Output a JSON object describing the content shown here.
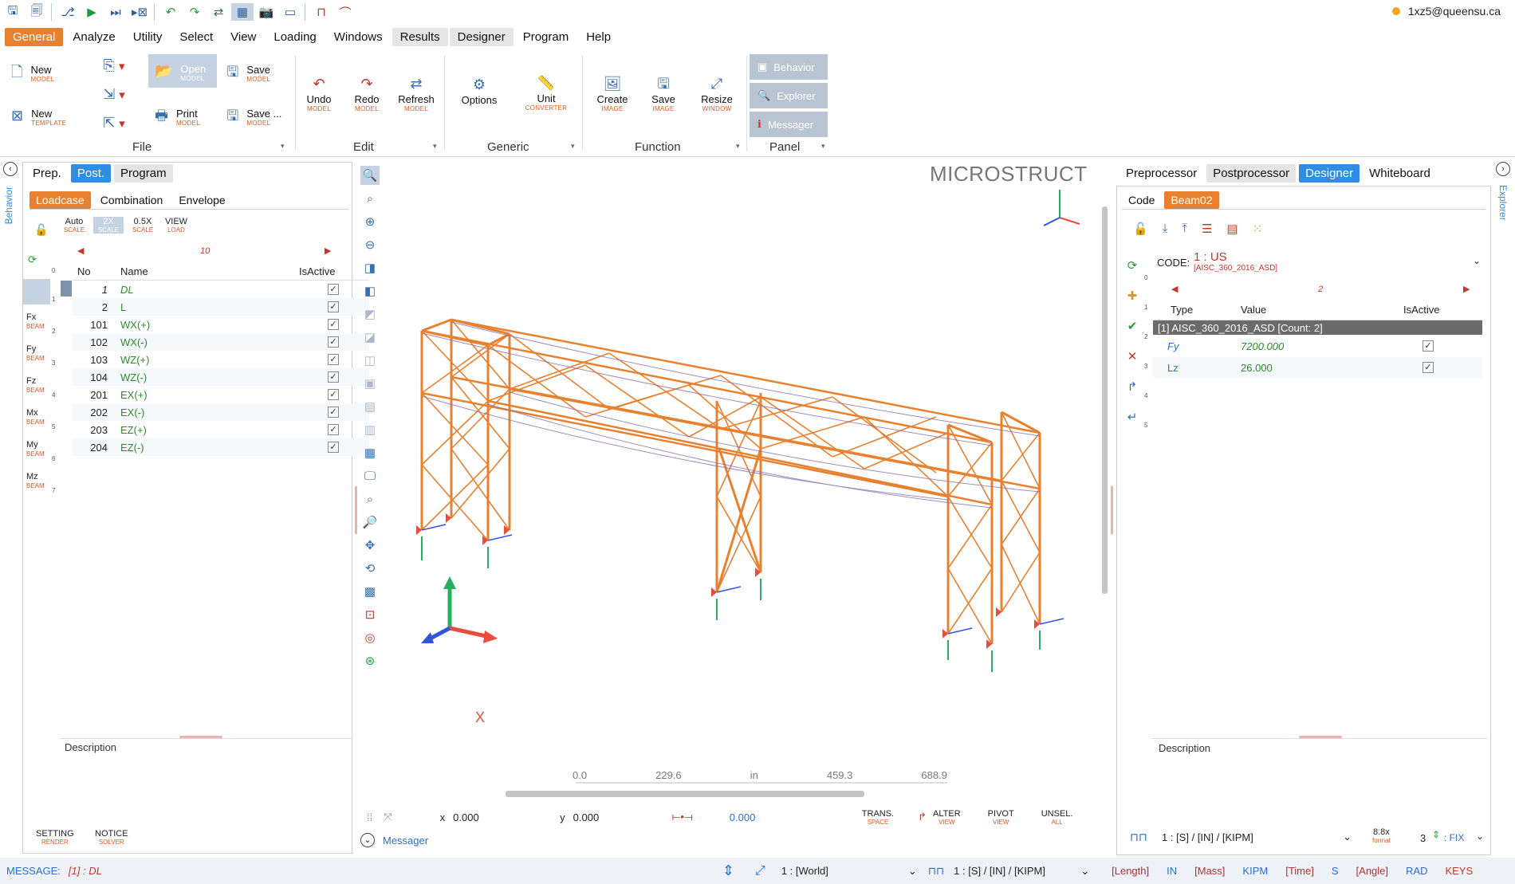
{
  "quick_access": {
    "icons": [
      "save-icon",
      "save-all-icon",
      "flow-icon",
      "run-icon",
      "step-icon",
      "next-frame-icon",
      "undo-icon",
      "redo-icon",
      "swap-icon",
      "layout-icon",
      "camera-icon",
      "window-icon",
      "beam-icon",
      "bridge-icon"
    ]
  },
  "user": {
    "email": "1xz5@queensu.ca",
    "status_color": "#f5a51c"
  },
  "menu": {
    "items": [
      "General",
      "Analyze",
      "Utility",
      "Select",
      "View",
      "Loading",
      "Windows",
      "Results",
      "Designer",
      "Program",
      "Help"
    ]
  },
  "ribbon": {
    "file": {
      "new_model": "New",
      "new_model_sub": "MODEL",
      "new_template": "New",
      "new_template_sub": "TEMPLATE",
      "open": "Open",
      "open_sub": "MODEL",
      "print": "Print",
      "print_sub": "MODEL",
      "save": "Save",
      "save_sub": "MODEL",
      "save_as": "Save ...",
      "save_as_sub": "MODEL",
      "group": "File"
    },
    "edit": {
      "undo": "Undo",
      "undo_sub": "MODEL",
      "redo": "Redo",
      "redo_sub": "MODEL",
      "refresh": "Refresh",
      "refresh_sub": "MODEL",
      "group": "Edit"
    },
    "generic": {
      "options": "Options",
      "unit": "Unit",
      "unit_sub": "CONVERTER",
      "group": "Generic"
    },
    "function": {
      "create": "Create",
      "create_sub": "IMAGE",
      "save": "Save",
      "save_sub": "IMAGE",
      "resize": "Resize",
      "resize_sub": "WINDOW",
      "group": "Function"
    },
    "panel": {
      "behavior": "Behavior",
      "explorer": "Explorer",
      "messager": "Messager",
      "group": "Panel"
    }
  },
  "left_panel": {
    "side_label": "Behavior",
    "tabs": [
      "Prep.",
      "Post.",
      "Program"
    ],
    "subtabs": [
      "Loadcase",
      "Combination",
      "Envelope"
    ],
    "scale": [
      {
        "t": "Auto",
        "s": "SCALE"
      },
      {
        "t": "2X",
        "s": "SCALE"
      },
      {
        "t": "0.5X",
        "s": "SCALE"
      },
      {
        "t": "VIEW",
        "s": "LOAD"
      }
    ],
    "pager": "10",
    "side_comps": [
      {
        "t": "Fx",
        "s": "BEAM"
      },
      {
        "t": "Fy",
        "s": "BEAM"
      },
      {
        "t": "Fz",
        "s": "BEAM"
      },
      {
        "t": "Mx",
        "s": "BEAM"
      },
      {
        "t": "My",
        "s": "BEAM"
      },
      {
        "t": "Mz",
        "s": "BEAM"
      }
    ],
    "side_nums": [
      "0",
      "1",
      "2",
      "3",
      "4",
      "5",
      "6",
      "7"
    ],
    "cols": {
      "no": "No",
      "name": "Name",
      "active": "IsActive"
    },
    "rows": [
      {
        "no": "1",
        "name": "DL"
      },
      {
        "no": "2",
        "name": "L"
      },
      {
        "no": "101",
        "name": "WX(+)"
      },
      {
        "no": "102",
        "name": "WX(-)"
      },
      {
        "no": "103",
        "name": "WZ(+)"
      },
      {
        "no": "104",
        "name": "WZ(-)"
      },
      {
        "no": "201",
        "name": "EX(+)"
      },
      {
        "no": "202",
        "name": "EX(-)"
      },
      {
        "no": "203",
        "name": "EZ(+)"
      },
      {
        "no": "204",
        "name": "EZ(-)"
      }
    ],
    "check": "✓",
    "description": "Description",
    "setting": "SETTING",
    "setting_sub": "RENDER",
    "notice": "NOTICE",
    "notice_sub": "SOLVER"
  },
  "viewport": {
    "brand": "MICROSTRUCT",
    "axis_x": "X",
    "scale_ticks": [
      "0.0",
      "229.6",
      "in",
      "459.3",
      "688.9"
    ],
    "x_label": "x",
    "x_val": "0.000",
    "y_label": "y",
    "y_val": "0.000",
    "d_val": "0.000",
    "trans": "TRANS.",
    "trans_sub": "SPACE",
    "alter": "ALTER",
    "alter_sub": "VIEW",
    "pivot": "PIVOT",
    "pivot_sub": "VIEW",
    "unsel": "UNSEL.",
    "unsel_sub": "ALL",
    "messager": "Messager",
    "frame_color": "#e8812f"
  },
  "right_panel": {
    "side_label": "Explorer",
    "tabs": [
      "Preprocessor",
      "Postprocessor",
      "Designer",
      "Whiteboard"
    ],
    "subtabs": [
      "Code",
      "Beam02"
    ],
    "code_label": "CODE:",
    "code_value": "1 : US",
    "code_sub": "[AISC_360_2016_ASD]",
    "pager": "2",
    "cols": {
      "type": "Type",
      "value": "Value",
      "active": "IsActive"
    },
    "group": "[1] AISC_360_2016_ASD   [Count: 2]",
    "rows": [
      {
        "type": "Fy",
        "value": "7200.000"
      },
      {
        "type": "Lz",
        "value": "26.000"
      }
    ],
    "check": "✓",
    "side_nums": [
      "0",
      "1",
      "2",
      "3",
      "4",
      "5"
    ],
    "description": "Description",
    "unit": "1 : [S] / [IN] / [KIPM]",
    "fmt": "8.8x",
    "fmt_sub": "format",
    "digits": "3",
    "fix": ": FIX"
  },
  "status": {
    "message_label": "MESSAGE:",
    "message": "[1] : DL",
    "world": "1 : [World]",
    "unit": "1 : [S] / [IN] / [KIPM]",
    "length": "[Length]",
    "in": "IN",
    "mass": "[Mass]",
    "kipm": "KIPM",
    "time": "[Time]",
    "s": "S",
    "angle": "[Angle]",
    "rad": "RAD",
    "keys": "KEYS"
  }
}
